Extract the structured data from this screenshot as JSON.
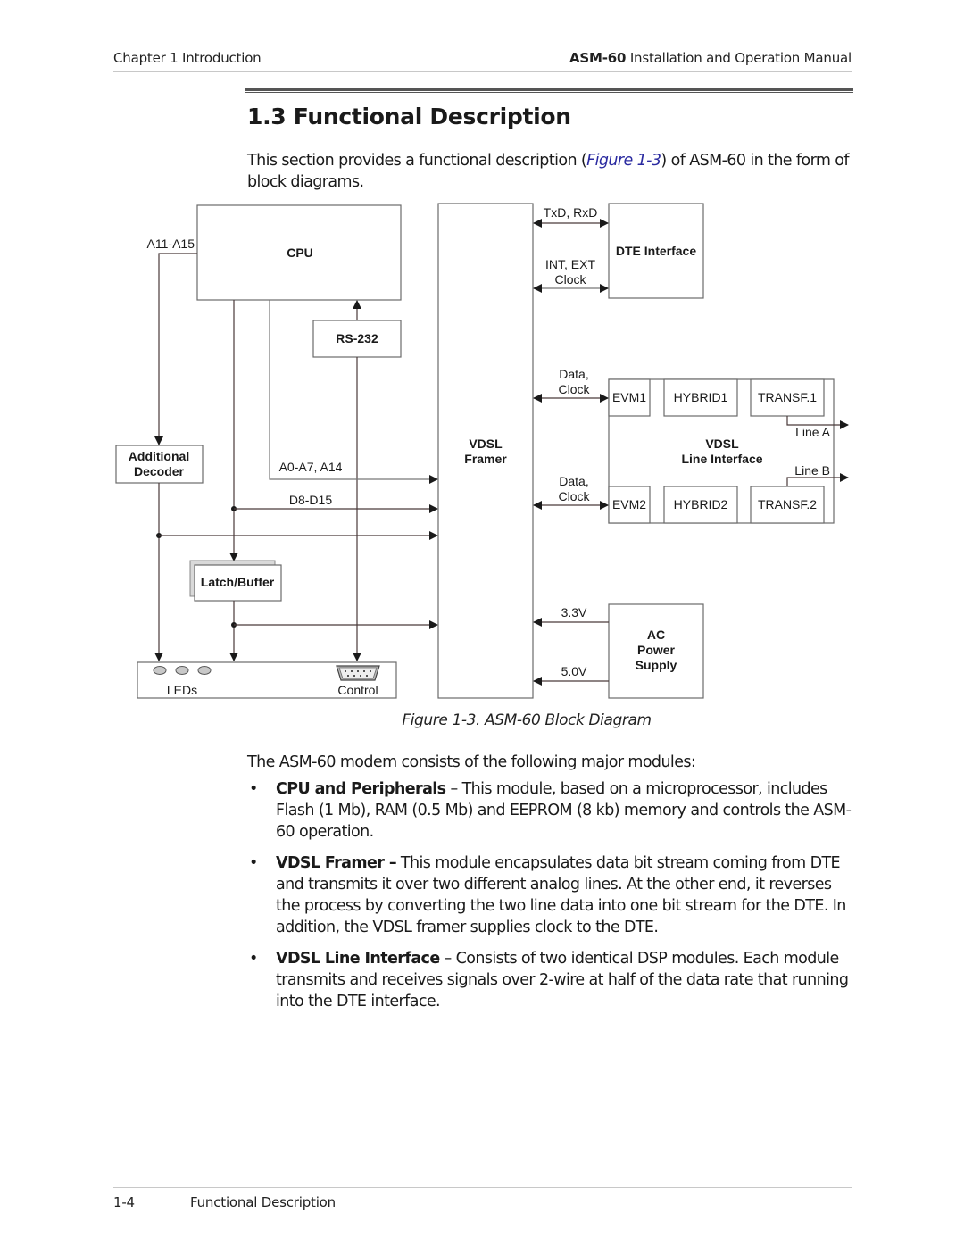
{
  "header": {
    "chapter": "Chapter 1  Introduction",
    "manual_bold": "ASM-60",
    "manual_rest": " Installation and Operation Manual"
  },
  "section": {
    "title": "1.3  Functional Description",
    "intro_before": "This section provides a functional description (",
    "intro_link": "Figure 1-3",
    "intro_after": ") of ASM-60 in the form of block diagrams."
  },
  "diagram": {
    "blocks": {
      "cpu": "CPU",
      "rs232": "RS-232",
      "additional_decoder_1": "Additional",
      "additional_decoder_2": "Decoder",
      "latch_buffer": "Latch/Buffer",
      "leds": "LEDs",
      "control": "Control",
      "framer_1": "VDSL",
      "framer_2": "Framer",
      "dte_interface": "DTE Interface",
      "line_if_1": "VDSL",
      "line_if_2": "Line Interface",
      "evm1": "EVM1",
      "hybrid1": "HYBRID1",
      "transf1": "TRANSF.1",
      "evm2": "EVM2",
      "hybrid2": "HYBRID2",
      "transf2": "TRANSF.2",
      "power_1": "AC",
      "power_2": "Power",
      "power_3": "Supply"
    },
    "signals": {
      "a11_a15": "A11-A15",
      "a0_a7_a14": "A0-A7, A14",
      "d8_d15": "D8-D15",
      "txd_rxd": "TxD, RxD",
      "int_ext": "INT, EXT",
      "clock": "Clock",
      "data1": "Data,",
      "clock1": "Clock",
      "data2": "Data,",
      "clock2": "Clock",
      "line_a": "Line A",
      "line_b": "Line B",
      "v33": "3.3V",
      "v50": "5.0V"
    },
    "caption": "Figure 1-3.  ASM-60 Block Diagram"
  },
  "body": {
    "lead": "The ASM-60 modem consists of the following major modules:",
    "bullet_glyph": "•",
    "modules": [
      {
        "name": "CPU and Peripherals",
        "text": " – This module, based on a microprocessor, includes Flash (1 Mb), RAM (0.5 Mb) and EEPROM (8 kb) memory and controls the ASM-60 operation."
      },
      {
        "name": "VDSL Framer –",
        "text": " This module encapsulates data bit stream coming from DTE and transmits it over two different analog lines. At the other end, it reverses the process by converting the two line data into one bit stream for the DTE. In addition, the VDSL framer supplies clock to the DTE."
      },
      {
        "name": "VDSL Line Interface",
        "text": " – Consists of two identical DSP modules. Each module transmits and receives signals over 2-wire at half of the data rate that running into the DTE interface."
      }
    ]
  },
  "footer": {
    "page": "1-4",
    "title": "Functional Description"
  }
}
